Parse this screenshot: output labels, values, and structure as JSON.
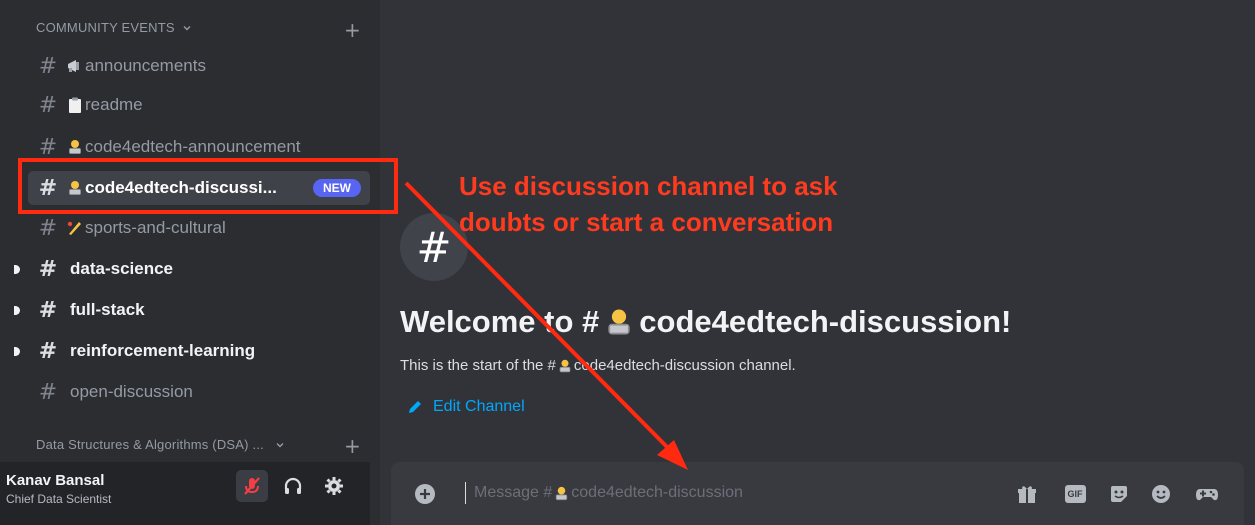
{
  "sidebar": {
    "category_1": "COMMUNITY EVENTS",
    "category_2": "Data Structures & Algorithms (DSA) ...",
    "channels": [
      {
        "label": "announcements",
        "emoji": "megaphone"
      },
      {
        "label": "readme",
        "emoji": "clipboard"
      },
      {
        "label": "code4edtech-announcement",
        "emoji": "technologist"
      },
      {
        "label": "code4edtech-discussi...",
        "emoji": "technologist",
        "badge": "NEW"
      },
      {
        "label": "sports-and-cultural",
        "emoji": "cricket"
      },
      {
        "label": "data-science"
      },
      {
        "label": "full-stack"
      },
      {
        "label": "reinforcement-learning"
      },
      {
        "label": "open-discussion"
      }
    ]
  },
  "user": {
    "name": "Kanav Bansal",
    "role": "Chief Data Scientist"
  },
  "welcome": {
    "title_prefix": "Welcome to #",
    "title_suffix": "code4edtech-discussion!",
    "sub_prefix": "This is the start of the #",
    "sub_suffix": "code4edtech-discussion channel.",
    "edit_label": "Edit Channel"
  },
  "composer": {
    "placeholder_prefix": "Message #",
    "placeholder_suffix": "code4edtech-discussion",
    "gif_label": "GIF"
  },
  "annotation": {
    "line1": "Use discussion channel to ask",
    "line2": "doubts or start a conversation",
    "color": "#ff3b1f"
  },
  "colors": {
    "sidebar_bg": "#2b2d31",
    "main_bg": "#313338",
    "active_channel": "#404249",
    "badge": "#5865f2",
    "link": "#00a8fc",
    "mute_red": "#f23f43"
  }
}
